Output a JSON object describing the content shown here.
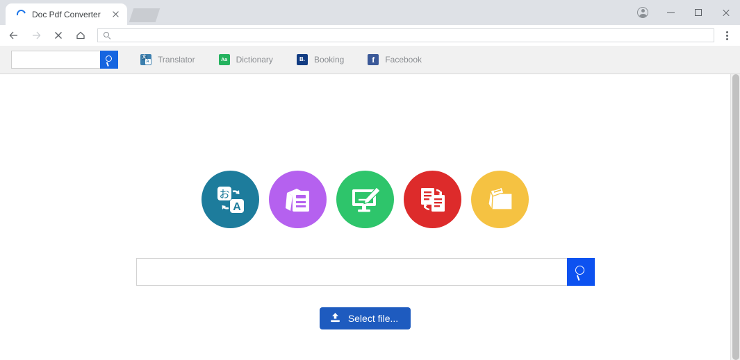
{
  "window": {
    "controls": {
      "profile": "profile-avatar",
      "minimize": "minimize",
      "maximize": "maximize",
      "close": "close"
    }
  },
  "tabs": [
    {
      "title": "Doc Pdf Converter",
      "favicon": "loading-spinner",
      "close_label": "×"
    }
  ],
  "toolbar": {
    "back": "back",
    "forward": "forward",
    "stop": "stop",
    "home": "home",
    "address_value": "",
    "address_placeholder": "",
    "menu": "browser-menu"
  },
  "bookmarks": {
    "search": {
      "value": "",
      "placeholder": ""
    },
    "items": [
      {
        "label": "Translator",
        "icon": "translator-icon",
        "glyph_primary": "文",
        "glyph_secondary": "A",
        "color": "#3c7fae"
      },
      {
        "label": "Dictionary",
        "icon": "dictionary-icon",
        "glyph": "Aa",
        "color": "#24b25e"
      },
      {
        "label": "Booking",
        "icon": "booking-icon",
        "glyph": "B.",
        "color": "#123c82"
      },
      {
        "label": "Facebook",
        "icon": "facebook-icon",
        "glyph": "f",
        "color": "#3b5998"
      }
    ]
  },
  "main": {
    "circles": [
      {
        "name": "translate-circle",
        "color": "#1d7c9c",
        "icon": "translate-icon"
      },
      {
        "name": "documents-circle",
        "color": "#b561ef",
        "icon": "documents-icon"
      },
      {
        "name": "edit-circle",
        "color": "#2ec56b",
        "icon": "monitor-edit-icon"
      },
      {
        "name": "convert-circle",
        "color": "#dd2b2b",
        "icon": "convert-documents-icon"
      },
      {
        "name": "folder-circle",
        "color": "#f5c242",
        "icon": "folder-icon"
      }
    ],
    "search": {
      "value": "",
      "placeholder": "",
      "button_icon": "search-icon",
      "button_color": "#0d52f0"
    },
    "select_file": {
      "label": "Select file...",
      "icon": "upload-icon",
      "color": "#1e5bbf"
    }
  }
}
